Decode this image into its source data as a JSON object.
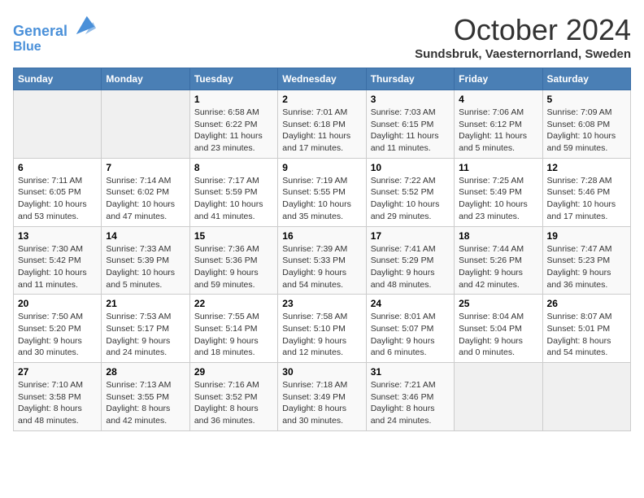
{
  "header": {
    "logo_line1": "General",
    "logo_line2": "Blue",
    "month": "October 2024",
    "location": "Sundsbruk, Vaesternorrland, Sweden"
  },
  "weekdays": [
    "Sunday",
    "Monday",
    "Tuesday",
    "Wednesday",
    "Thursday",
    "Friday",
    "Saturday"
  ],
  "weeks": [
    [
      {
        "day": "",
        "text": ""
      },
      {
        "day": "",
        "text": ""
      },
      {
        "day": "1",
        "text": "Sunrise: 6:58 AM\nSunset: 6:22 PM\nDaylight: 11 hours and 23 minutes."
      },
      {
        "day": "2",
        "text": "Sunrise: 7:01 AM\nSunset: 6:18 PM\nDaylight: 11 hours and 17 minutes."
      },
      {
        "day": "3",
        "text": "Sunrise: 7:03 AM\nSunset: 6:15 PM\nDaylight: 11 hours and 11 minutes."
      },
      {
        "day": "4",
        "text": "Sunrise: 7:06 AM\nSunset: 6:12 PM\nDaylight: 11 hours and 5 minutes."
      },
      {
        "day": "5",
        "text": "Sunrise: 7:09 AM\nSunset: 6:08 PM\nDaylight: 10 hours and 59 minutes."
      }
    ],
    [
      {
        "day": "6",
        "text": "Sunrise: 7:11 AM\nSunset: 6:05 PM\nDaylight: 10 hours and 53 minutes."
      },
      {
        "day": "7",
        "text": "Sunrise: 7:14 AM\nSunset: 6:02 PM\nDaylight: 10 hours and 47 minutes."
      },
      {
        "day": "8",
        "text": "Sunrise: 7:17 AM\nSunset: 5:59 PM\nDaylight: 10 hours and 41 minutes."
      },
      {
        "day": "9",
        "text": "Sunrise: 7:19 AM\nSunset: 5:55 PM\nDaylight: 10 hours and 35 minutes."
      },
      {
        "day": "10",
        "text": "Sunrise: 7:22 AM\nSunset: 5:52 PM\nDaylight: 10 hours and 29 minutes."
      },
      {
        "day": "11",
        "text": "Sunrise: 7:25 AM\nSunset: 5:49 PM\nDaylight: 10 hours and 23 minutes."
      },
      {
        "day": "12",
        "text": "Sunrise: 7:28 AM\nSunset: 5:46 PM\nDaylight: 10 hours and 17 minutes."
      }
    ],
    [
      {
        "day": "13",
        "text": "Sunrise: 7:30 AM\nSunset: 5:42 PM\nDaylight: 10 hours and 11 minutes."
      },
      {
        "day": "14",
        "text": "Sunrise: 7:33 AM\nSunset: 5:39 PM\nDaylight: 10 hours and 5 minutes."
      },
      {
        "day": "15",
        "text": "Sunrise: 7:36 AM\nSunset: 5:36 PM\nDaylight: 9 hours and 59 minutes."
      },
      {
        "day": "16",
        "text": "Sunrise: 7:39 AM\nSunset: 5:33 PM\nDaylight: 9 hours and 54 minutes."
      },
      {
        "day": "17",
        "text": "Sunrise: 7:41 AM\nSunset: 5:29 PM\nDaylight: 9 hours and 48 minutes."
      },
      {
        "day": "18",
        "text": "Sunrise: 7:44 AM\nSunset: 5:26 PM\nDaylight: 9 hours and 42 minutes."
      },
      {
        "day": "19",
        "text": "Sunrise: 7:47 AM\nSunset: 5:23 PM\nDaylight: 9 hours and 36 minutes."
      }
    ],
    [
      {
        "day": "20",
        "text": "Sunrise: 7:50 AM\nSunset: 5:20 PM\nDaylight: 9 hours and 30 minutes."
      },
      {
        "day": "21",
        "text": "Sunrise: 7:53 AM\nSunset: 5:17 PM\nDaylight: 9 hours and 24 minutes."
      },
      {
        "day": "22",
        "text": "Sunrise: 7:55 AM\nSunset: 5:14 PM\nDaylight: 9 hours and 18 minutes."
      },
      {
        "day": "23",
        "text": "Sunrise: 7:58 AM\nSunset: 5:10 PM\nDaylight: 9 hours and 12 minutes."
      },
      {
        "day": "24",
        "text": "Sunrise: 8:01 AM\nSunset: 5:07 PM\nDaylight: 9 hours and 6 minutes."
      },
      {
        "day": "25",
        "text": "Sunrise: 8:04 AM\nSunset: 5:04 PM\nDaylight: 9 hours and 0 minutes."
      },
      {
        "day": "26",
        "text": "Sunrise: 8:07 AM\nSunset: 5:01 PM\nDaylight: 8 hours and 54 minutes."
      }
    ],
    [
      {
        "day": "27",
        "text": "Sunrise: 7:10 AM\nSunset: 3:58 PM\nDaylight: 8 hours and 48 minutes."
      },
      {
        "day": "28",
        "text": "Sunrise: 7:13 AM\nSunset: 3:55 PM\nDaylight: 8 hours and 42 minutes."
      },
      {
        "day": "29",
        "text": "Sunrise: 7:16 AM\nSunset: 3:52 PM\nDaylight: 8 hours and 36 minutes."
      },
      {
        "day": "30",
        "text": "Sunrise: 7:18 AM\nSunset: 3:49 PM\nDaylight: 8 hours and 30 minutes."
      },
      {
        "day": "31",
        "text": "Sunrise: 7:21 AM\nSunset: 3:46 PM\nDaylight: 8 hours and 24 minutes."
      },
      {
        "day": "",
        "text": ""
      },
      {
        "day": "",
        "text": ""
      }
    ]
  ]
}
